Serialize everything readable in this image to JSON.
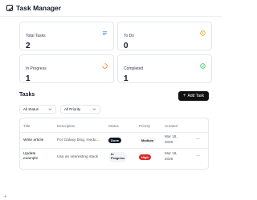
{
  "app": {
    "title": "Task Manager",
    "logo_icon": "checkbox-icon"
  },
  "stats": [
    {
      "label": "Total Tasks",
      "value": "2",
      "icon": "list-icon",
      "color": "#3b82f6"
    },
    {
      "label": "To Do",
      "value": "0",
      "icon": "clock-icon",
      "color": "#f59e0b"
    },
    {
      "label": "In Progress",
      "value": "1",
      "icon": "spinner-icon",
      "color": "#f97316"
    },
    {
      "label": "Completed",
      "value": "1",
      "icon": "check-circle-icon",
      "color": "#22c55e"
    }
  ],
  "tasks_section": {
    "title": "Tasks",
    "add_button_label": "Add Task",
    "add_icon": "plus-icon"
  },
  "filters": {
    "status": "All Status",
    "priority": "All Priority"
  },
  "table": {
    "columns": [
      "Title",
      "Description",
      "Status",
      "Priority",
      "Created"
    ],
    "rows": [
      {
        "title": "Write article",
        "description": "For Galaxy blog, medu...",
        "status": "Done",
        "priority": "Medium",
        "created_line1": "Mar 18,",
        "created_line2": "2026",
        "menu": "···"
      },
      {
        "title_line1": "Update",
        "title_line2": "example",
        "description": "Use an interesting stack",
        "status_line1": "In",
        "status_line2": "Progress",
        "priority": "High",
        "created_line1": "Mar 18,",
        "created_line2": "2026",
        "menu": "···"
      }
    ]
  },
  "colors": {
    "primary": "#111111",
    "high": "#dc2626"
  }
}
